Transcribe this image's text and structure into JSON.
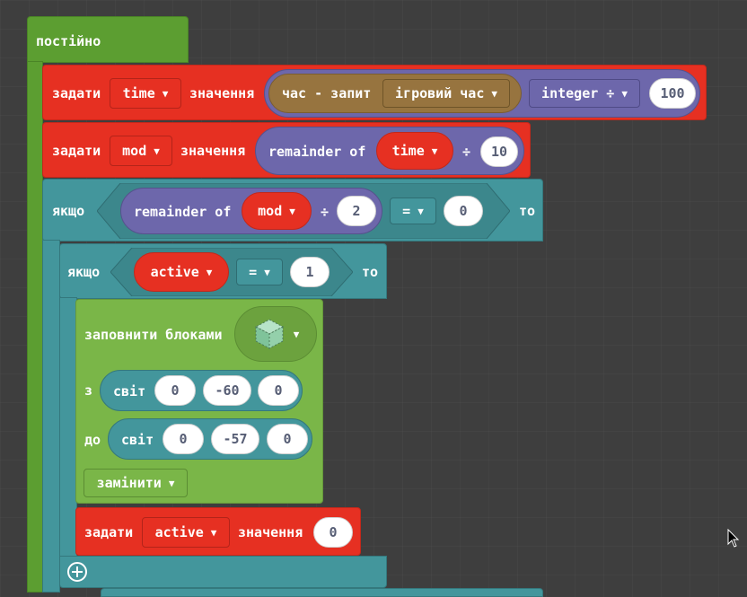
{
  "forever": {
    "label": "постійно"
  },
  "set_time": {
    "label_set": "задати",
    "variable": "time",
    "label_value": "значення",
    "query_label": "час - запит",
    "query_option": "ігровий час",
    "convert_option": "integer ÷",
    "number": "100"
  },
  "set_mod": {
    "label_set": "задати",
    "variable": "mod",
    "label_value": "значення",
    "op_label": "remainder of",
    "var_ref": "time",
    "divide": "÷",
    "number": "10"
  },
  "if_outer": {
    "label_if": "якщо",
    "op_label": "remainder of",
    "var_ref": "mod",
    "divide": "÷",
    "divisor": "2",
    "compare": "=",
    "compare_value": "0",
    "label_then": "то"
  },
  "if_inner": {
    "label_if": "якщо",
    "var_ref": "active",
    "compare": "=",
    "compare_value": "1",
    "label_then": "то"
  },
  "fill": {
    "label": "заповнити блоками",
    "from_label": "з",
    "to_label": "до",
    "world_label": "світ",
    "from": [
      "0",
      "-60",
      "0"
    ],
    "to": [
      "0",
      "-57",
      "0"
    ],
    "mode": "замінити"
  },
  "set_active": {
    "label_set": "задати",
    "variable": "active",
    "label_value": "значення",
    "number": "0"
  },
  "add_button": {
    "icon": "plus-circle-icon"
  },
  "arrow_glyph": "▼",
  "colors": {
    "loops": "#5c9e31",
    "variables": "#e63022",
    "logic": "#43969c",
    "blocks": "#7ab648",
    "math": "#6d67ab",
    "gameplay": "#97743f"
  }
}
